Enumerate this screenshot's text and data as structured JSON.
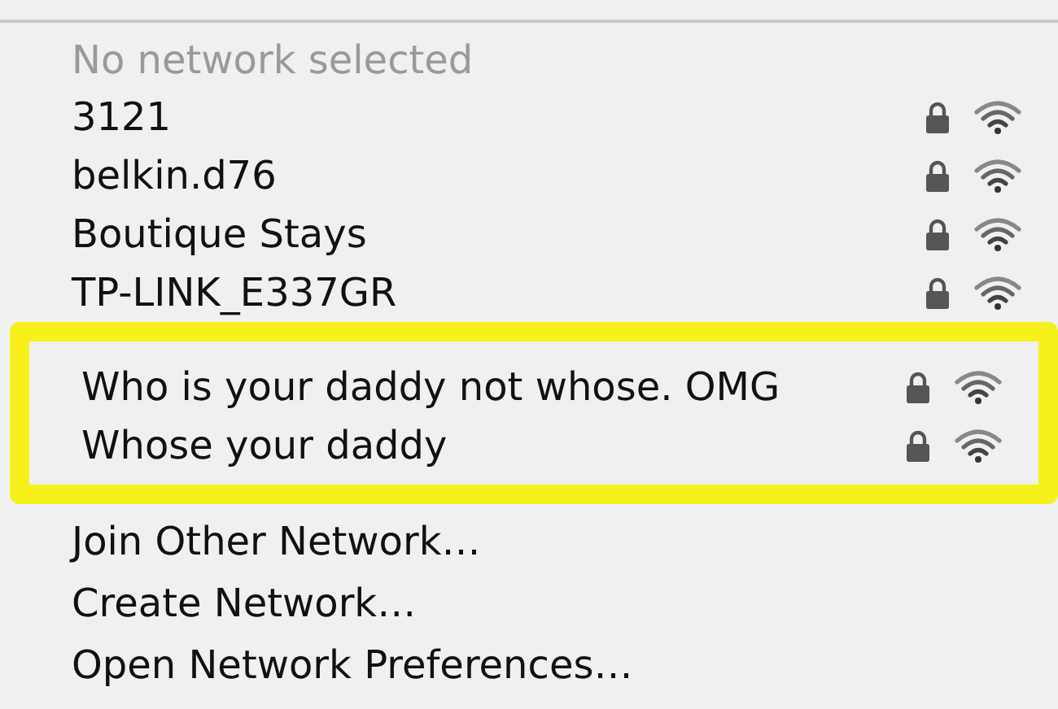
{
  "status": "No network selected",
  "networks": [
    {
      "name": "3121",
      "secured": true
    },
    {
      "name": "belkin.d76",
      "secured": true
    },
    {
      "name": "Boutique Stays",
      "secured": true
    },
    {
      "name": "TP-LINK_E337GR",
      "secured": true
    }
  ],
  "highlighted_networks": [
    {
      "name": "Who is your daddy not whose. OMG",
      "secured": true
    },
    {
      "name": "Whose your daddy",
      "secured": true
    }
  ],
  "actions": [
    "Join Other Network…",
    "Create Network…",
    "Open Network Preferences…"
  ]
}
